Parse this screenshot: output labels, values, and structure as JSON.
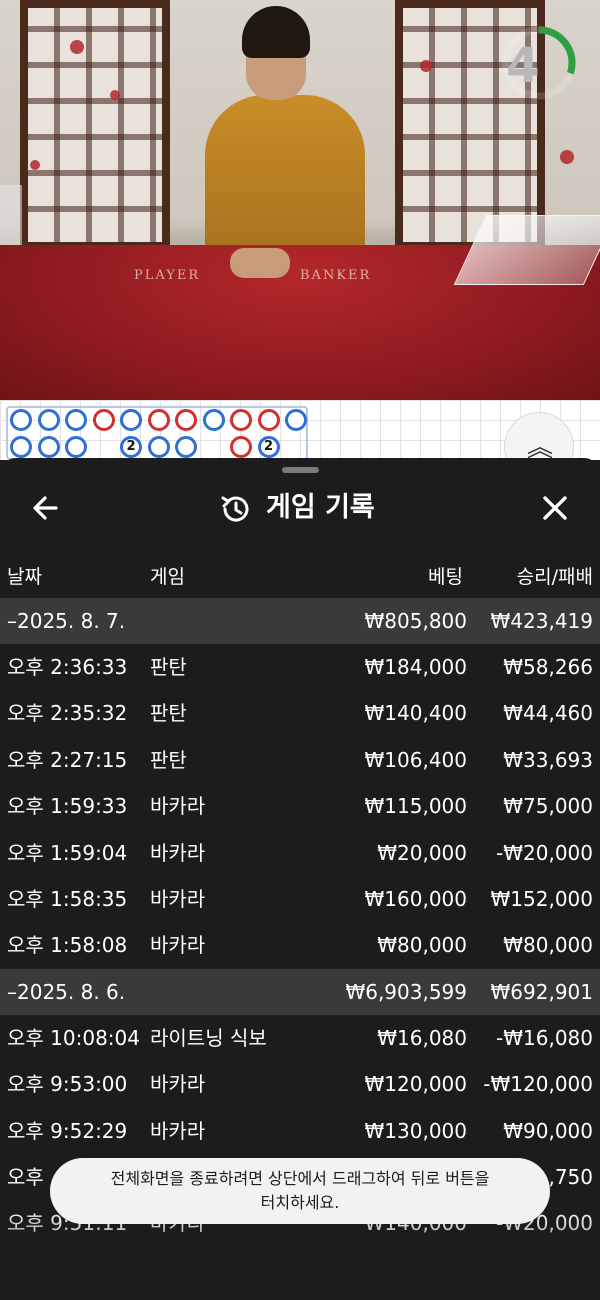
{
  "video": {
    "table_player_text": "PLAYER",
    "table_banker_text": "BANKER",
    "countdown": "4",
    "countdown_progress": 0.3
  },
  "road": {
    "row1": [
      "blue",
      "blue",
      "blue",
      "red",
      "blue",
      "red",
      "red",
      "blue",
      "red",
      "red",
      "blue"
    ],
    "row2": [
      "blue",
      "blue",
      "blue",
      "",
      "blue",
      "blue",
      "blue",
      "",
      "red",
      "blue",
      ""
    ],
    "row2_numbers": [
      "",
      "",
      "",
      "",
      "2",
      "",
      "",
      "",
      "",
      "2",
      ""
    ],
    "collapse_icon": "chevron-double-up-icon"
  },
  "sheet": {
    "title": "게임 기록",
    "back_icon": "arrow-left-icon",
    "history_icon": "history-icon",
    "close_icon": "close-icon",
    "columns": {
      "date": "날짜",
      "game": "게임",
      "bet": "베팅",
      "result": "승리/패배"
    },
    "groups": [
      {
        "date": "–2025. 8. 7.",
        "bet_total": "₩805,800",
        "result_total": "₩423,419",
        "rows": [
          {
            "time": "오후 2:36:33",
            "game": "판탄",
            "bet": "₩184,000",
            "result": "₩58,266"
          },
          {
            "time": "오후 2:35:32",
            "game": "판탄",
            "bet": "₩140,400",
            "result": "₩44,460"
          },
          {
            "time": "오후 2:27:15",
            "game": "판탄",
            "bet": "₩106,400",
            "result": "₩33,693"
          },
          {
            "time": "오후 1:59:33",
            "game": "바카라",
            "bet": "₩115,000",
            "result": "₩75,000"
          },
          {
            "time": "오후 1:59:04",
            "game": "바카라",
            "bet": "₩20,000",
            "result": "-₩20,000"
          },
          {
            "time": "오후 1:58:35",
            "game": "바카라",
            "bet": "₩160,000",
            "result": "₩152,000"
          },
          {
            "time": "오후 1:58:08",
            "game": "바카라",
            "bet": "₩80,000",
            "result": "₩80,000"
          }
        ]
      },
      {
        "date": "–2025. 8. 6.",
        "bet_total": "₩6,903,599",
        "result_total": "₩692,901",
        "rows": [
          {
            "time": "오후 10:08:04",
            "game": "라이트닝 식보",
            "bet": "₩16,080",
            "result": "-₩16,080"
          },
          {
            "time": "오후 9:53:00",
            "game": "바카라",
            "bet": "₩120,000",
            "result": "-₩120,000"
          },
          {
            "time": "오후 9:52:29",
            "game": "바카라",
            "bet": "₩130,000",
            "result": "₩90,000"
          },
          {
            "time": "오후",
            "game": "",
            "bet": "",
            "result": ",750"
          },
          {
            "time": "오후 9:51:11",
            "game": "바카라",
            "bet": "₩140,000",
            "result": "-₩20,000"
          }
        ]
      }
    ]
  },
  "toast": {
    "line1": "전체화면을 종료하려면 상단에서 드래그하여 뒤로 버튼을",
    "line2": "터치하세요."
  },
  "colors": {
    "sheet_bg": "#1c1c1e",
    "group_bg": "#3a3a3c",
    "timer_green": "#2ea043",
    "bead_blue": "#2f6fd6",
    "bead_red": "#d32f2f"
  }
}
